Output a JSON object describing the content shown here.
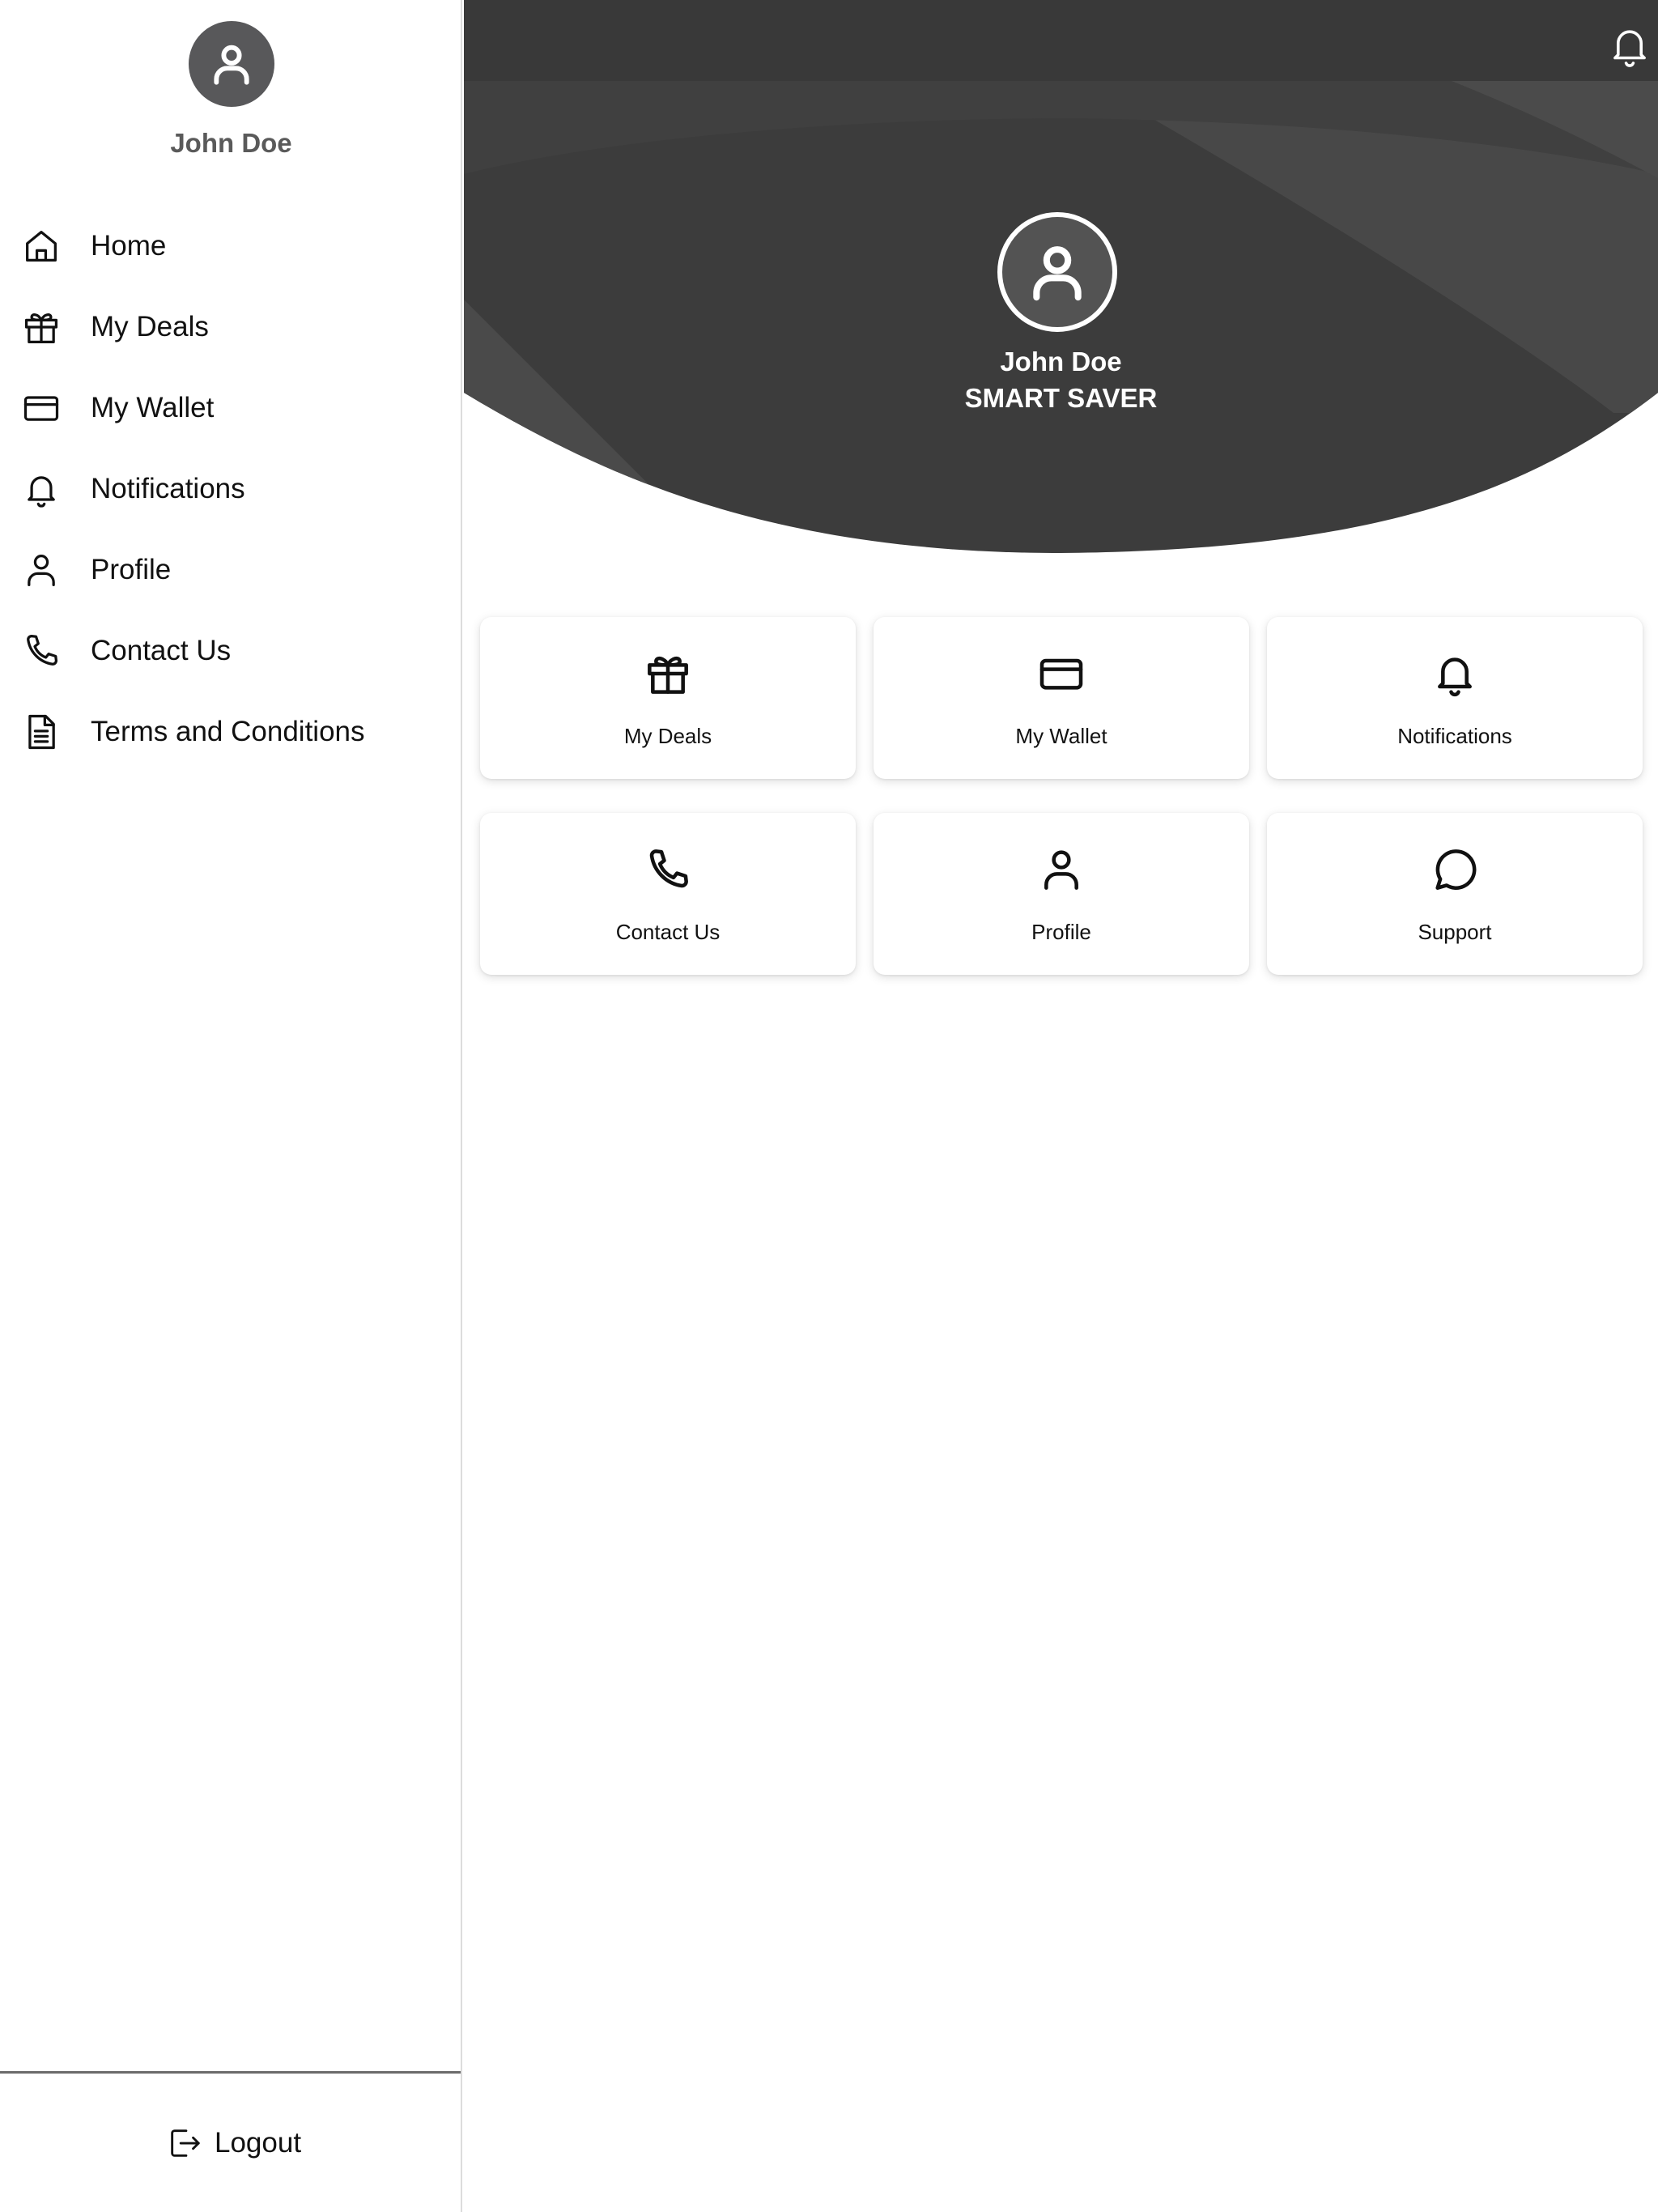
{
  "sidebar": {
    "user_name": "John Doe",
    "items": [
      {
        "label": "Home",
        "icon": "home-icon"
      },
      {
        "label": "My Deals",
        "icon": "gift-icon"
      },
      {
        "label": "My Wallet",
        "icon": "credit-card-icon"
      },
      {
        "label": "Notifications",
        "icon": "bell-icon"
      },
      {
        "label": "Profile",
        "icon": "user-icon"
      },
      {
        "label": "Contact Us",
        "icon": "phone-icon"
      },
      {
        "label": "Terms and Conditions",
        "icon": "document-icon"
      }
    ],
    "logout_label": "Logout"
  },
  "header": {
    "user_name": "John Doe",
    "tier": "SMART SAVER",
    "notification_icon": "bell-icon"
  },
  "tiles": [
    {
      "label": "My Deals",
      "icon": "gift-icon"
    },
    {
      "label": "My Wallet",
      "icon": "credit-card-icon"
    },
    {
      "label": "Notifications",
      "icon": "bell-icon"
    },
    {
      "label": "Contact Us",
      "icon": "phone-icon"
    },
    {
      "label": "Profile",
      "icon": "user-icon"
    },
    {
      "label": "Support",
      "icon": "chat-bubble-icon"
    }
  ],
  "colors": {
    "header_dark": "#393939",
    "header_shape": "#4a4a4a",
    "avatar_fill": "#58585a",
    "sidebar_name": "#5a5a5a"
  }
}
